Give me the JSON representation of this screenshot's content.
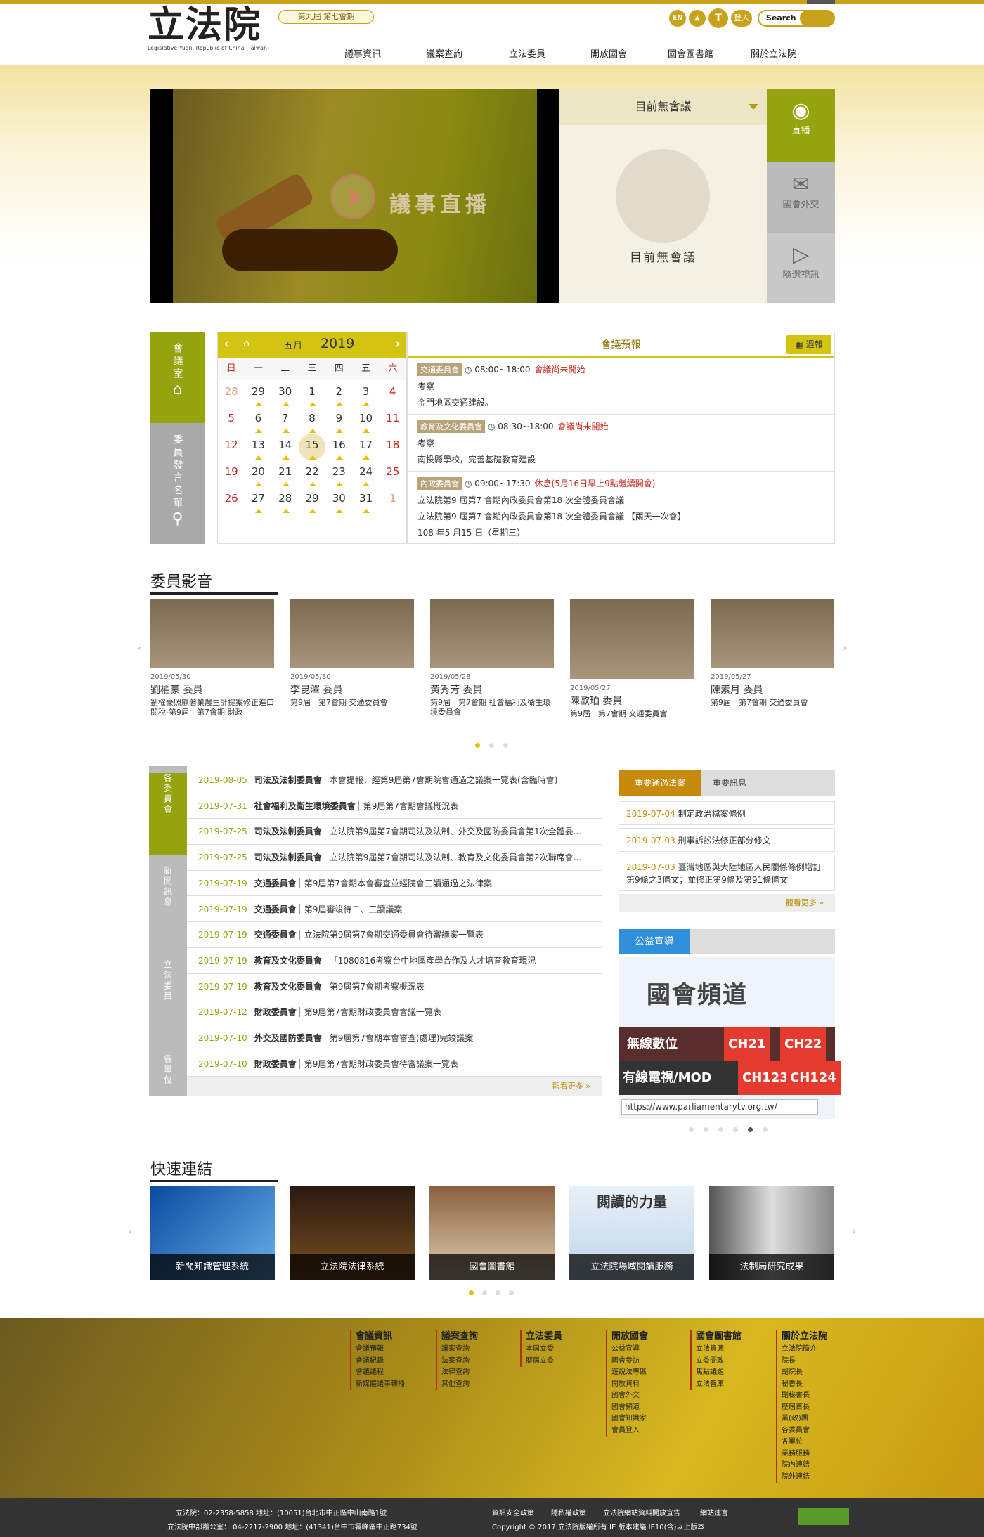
{
  "header": {
    "logo_cn": "立法院",
    "logo_en": "Legislative Yuan, Republic of China (Taiwan)",
    "session": "第九屆 第七會期",
    "nav": [
      "議事資訊",
      "議案查詢",
      "立法委員",
      "開放國會",
      "國會圖書館",
      "關於立法院"
    ],
    "lang": "EN",
    "login": "登入",
    "search": "Search"
  },
  "hero": {
    "title": "議事直播",
    "status": "目前無會議",
    "status_label": "目前無會議",
    "side": [
      "直播",
      "國會外交",
      "隨選視訊"
    ]
  },
  "calendar": {
    "side1": "會議室",
    "side2": "委員發言名單",
    "month": "五月",
    "year": "2019",
    "dow": [
      "日",
      "一",
      "二",
      "三",
      "四",
      "五",
      "六"
    ],
    "weeks": [
      [
        "28",
        "29",
        "30",
        "1",
        "2",
        "3",
        "4"
      ],
      [
        "5",
        "6",
        "7",
        "8",
        "9",
        "10",
        "11"
      ],
      [
        "12",
        "13",
        "14",
        "15",
        "16",
        "17",
        "18"
      ],
      [
        "19",
        "20",
        "21",
        "22",
        "23",
        "24",
        "25"
      ],
      [
        "26",
        "27",
        "28",
        "29",
        "30",
        "31",
        "1"
      ]
    ]
  },
  "schedule": {
    "title": "會議預報",
    "weekly": "週報",
    "items": [
      {
        "tag": "交通委員會",
        "time": "08:00~18:00",
        "status": "會議尚未開始",
        "l1": "考察",
        "l2": "金門地區交通建設。"
      },
      {
        "tag": "教育及文化委員會",
        "time": "08:30~18:00",
        "status": "會議尚未開始",
        "l1": "考察",
        "l2": "南投縣學校，完善基礎教育建設"
      },
      {
        "tag": "內政委員會",
        "time": "09:00~17:30",
        "status": "休息(5月16日早上9點繼續開會)",
        "l1": "立法院第9 屆第7 會期內政委員會第18 次全體委員會議",
        "l2": "立法院第9 屆第7 會期內政委員會第18 次全體委員會議 【兩天一次會】",
        "l3": "108 年5 月15 日（星期三）"
      }
    ]
  },
  "videos": {
    "title": "委員影音",
    "items": [
      {
        "date": "2019/05/30",
        "name": "劉櫂豪 委員",
        "desc": "劉櫂豪照顧著業農生計提案修正進口關稅-第9屆　第7會期 財政"
      },
      {
        "date": "2019/05/30",
        "name": "李昆澤 委員",
        "desc": "第9屆　第7會期 交通委員會"
      },
      {
        "date": "2019/05/28",
        "name": "黃秀芳 委員",
        "desc": "第9屆　第7會期 社會福利及衛生環境委員會"
      },
      {
        "date": "2019/05/27",
        "name": "陳歐珀 委員",
        "desc": "第9屆　第7會期 交通委員會"
      },
      {
        "date": "2019/05/27",
        "name": "陳素月 委員",
        "desc": "第9屆　第7會期 交通委員會"
      }
    ]
  },
  "news": {
    "tabs": [
      "各委員會",
      "新聞訊息",
      "立法委員",
      "各單位"
    ],
    "more": "觀看更多 »",
    "rows": [
      {
        "d": "2019-08-05",
        "c": "司法及法制委員會",
        "t": "本會提報，經第9屆第7會期院會通過之議案一覽表(含臨時會)"
      },
      {
        "d": "2019-07-31",
        "c": "社會福利及衛生環境委員會",
        "t": "第9屆第7會期會議概況表"
      },
      {
        "d": "2019-07-25",
        "c": "司法及法制委員會",
        "t": "立法院第9屆第7會期司法及法制、外交及國防委員會第1次全體委..."
      },
      {
        "d": "2019-07-25",
        "c": "司法及法制委員會",
        "t": "立法院第9屆第7會期司法及法制、教育及文化委員會第2次聯席會..."
      },
      {
        "d": "2019-07-19",
        "c": "交通委員會",
        "t": "第9屆第7會期本會審查並經院會三讀通過之法律案"
      },
      {
        "d": "2019-07-19",
        "c": "交通委員會",
        "t": "第9屆審竣待二、三讀議案"
      },
      {
        "d": "2019-07-19",
        "c": "交通委員會",
        "t": "立法院第9屆第7會期交通委員會待審議案一覽表"
      },
      {
        "d": "2019-07-19",
        "c": "教育及文化委員會",
        "t": "「1080816考察台中地區產學合作及人才培育教育現況"
      },
      {
        "d": "2019-07-19",
        "c": "教育及文化委員會",
        "t": "第9屆第7會期考察概況表"
      },
      {
        "d": "2019-07-12",
        "c": "財政委員會",
        "t": "第9屆第7會期財政委員會會議一覽表"
      },
      {
        "d": "2019-07-10",
        "c": "外交及國防委員會",
        "t": "第9屆第7會期本會審查(處理)完竣議案"
      },
      {
        "d": "2019-07-10",
        "c": "財政委員會",
        "t": "第9屆第7會期財政委員會待審議案一覽表"
      }
    ]
  },
  "bills": {
    "tab_a": "重要通過法案",
    "tab_b": "重要訊息",
    "more": "觀看更多 »",
    "items": [
      {
        "d": "2019-07-04",
        "t": "制定政治檔案條例"
      },
      {
        "d": "2019-07-03",
        "t": "刑事訴訟法修正部分條文"
      },
      {
        "d": "2019-07-03",
        "t": "臺灣地區與大陸地區人民關係條例增訂第9條之3條文；並修正第9條及第91條條文"
      }
    ]
  },
  "promo": {
    "title": "公益宣導",
    "logo": "國會頻道",
    "r1": "無線數位",
    "r1a": "CH21",
    "r1b": "CH22",
    "r2": "有線電視/MOD",
    "r2a": "CH123",
    "r2b": "CH124",
    "url": "https://www.parliamentarytv.org.tw/"
  },
  "quick": {
    "title": "快速連結",
    "items": [
      "新聞知識管理系統",
      "立法院法律系統",
      "國會圖書館",
      "立法院場域閱讀服務",
      "法制局研究成果"
    ],
    "banner": "閱讀的力量"
  },
  "footer": {
    "cols": [
      {
        "h": "會議資訊",
        "l": [
          "會議預報",
          "會議紀錄",
          "會議議程",
          "新媒體議事轉播"
        ]
      },
      {
        "h": "議案查詢",
        "l": [
          "議案查詢",
          "法案查詢",
          "法律查詢",
          "其他查詢"
        ]
      },
      {
        "h": "立法委員",
        "l": [
          "本屆立委",
          "歷屆立委"
        ]
      },
      {
        "h": "開放國會",
        "l": [
          "公益宣導",
          "國會參訪",
          "遊說法專區",
          "開放資料",
          "國會外交",
          "國會頻道",
          "國會知識家",
          "會員登入"
        ]
      },
      {
        "h": "國會圖書館",
        "l": [
          "立法資源",
          "立委問政",
          "焦點議題",
          "立法智庫"
        ]
      },
      {
        "h": "關於立法院",
        "l": [
          "立法院簡介",
          "院長",
          "副院長",
          "秘書長",
          "副秘書長",
          "歷屆首長",
          "黨(政)團",
          "各委員會",
          "各單位",
          "業務服務",
          "院內連結",
          "院外連結"
        ]
      }
    ],
    "addr1": "立法院：02-2358-5858  地址：(10051)台北市中正區中山南路1號",
    "addr2": "立法院中部辦公室： 04-2217-2900  地址：(41341)台中市霧峰區中正路734號",
    "links": [
      "資訊安全政策",
      "隱私權政策",
      "立法院網站資料開放宣告",
      "網站建言"
    ],
    "copy": "Copyright © 2017 立法院版權所有 IE 版本建議 IE10(含)以上版本"
  }
}
